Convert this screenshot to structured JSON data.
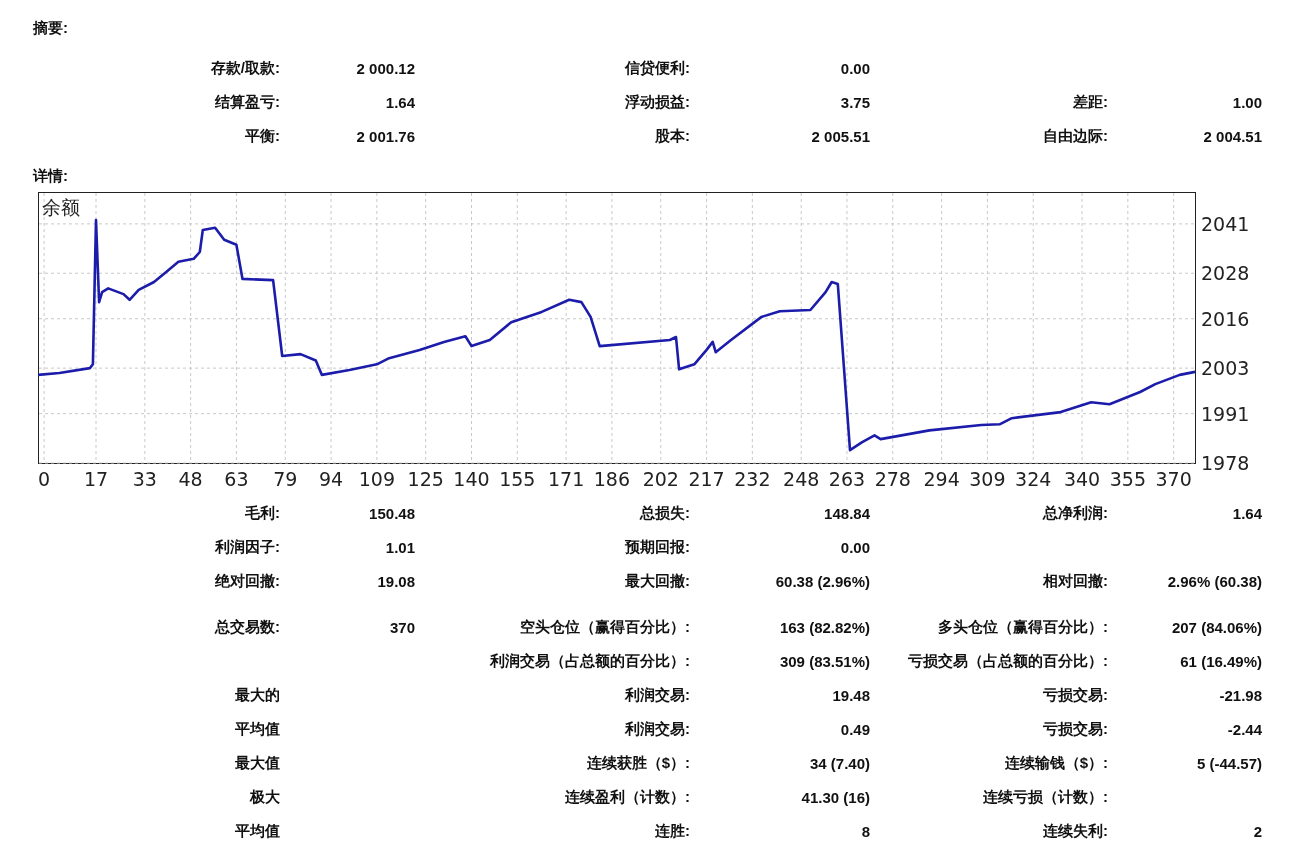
{
  "summary": {
    "heading": "摘要:",
    "rows": [
      {
        "left": {
          "label": "存款/取款:",
          "value": "2 000.12"
        },
        "middle": {
          "label": "信贷便利:",
          "value": "0.00"
        }
      },
      {
        "left": {
          "label": "结算盈亏:",
          "value": "1.64"
        },
        "middle": {
          "label": "浮动损益:",
          "value": "3.75"
        },
        "right": {
          "label": "差距:",
          "value": "1.00"
        }
      },
      {
        "left": {
          "label": "平衡:",
          "value": "2 001.76"
        },
        "middle": {
          "label": "股本:",
          "value": "2 005.51"
        },
        "right": {
          "label": "自由边际:",
          "value": "2 004.51"
        }
      }
    ]
  },
  "details": {
    "heading": "详情:",
    "chart_data": {
      "type": "line",
      "title": "余额",
      "grid": true,
      "xlim": [
        -2,
        377
      ],
      "ylim": [
        1978,
        2049.4
      ],
      "xticks": [
        0,
        17,
        33,
        48,
        63,
        79,
        94,
        109,
        125,
        140,
        155,
        171,
        186,
        202,
        217,
        232,
        248,
        263,
        278,
        294,
        309,
        324,
        340,
        355,
        370
      ],
      "yticks": [
        1978,
        1991,
        2003,
        2016,
        2028,
        2041
      ],
      "x": [
        -2,
        5,
        15,
        16,
        17,
        18,
        19,
        21,
        26,
        28,
        31,
        36,
        40,
        44,
        49,
        51,
        52,
        56,
        59,
        63,
        65,
        75,
        78,
        84,
        89,
        91,
        100,
        109,
        113,
        123,
        131,
        138,
        140,
        146,
        153,
        163,
        172,
        176,
        179,
        182,
        205,
        207,
        208,
        213,
        217,
        219,
        220,
        225,
        235,
        241,
        251,
        256,
        258,
        260,
        264,
        268,
        272,
        274,
        290,
        307,
        313,
        317,
        333,
        343,
        349,
        359,
        364,
        372,
        377
      ],
      "series": [
        {
          "color": "#1c1cab",
          "values": [
            2001.2,
            2001.7,
            2003,
            2004,
            2042,
            2020.4,
            2023,
            2024,
            2022.5,
            2021,
            2023.6,
            2025.7,
            2028.3,
            2031,
            2031.8,
            2033.6,
            2039.4,
            2040,
            2036.8,
            2035.5,
            2026.5,
            2026.2,
            2006.2,
            2006.7,
            2005,
            2001.2,
            2002.5,
            2004,
            2005.6,
            2007.8,
            2009.9,
            2011.4,
            2008.8,
            2010.4,
            2015.1,
            2017.8,
            2021,
            2020.4,
            2016.5,
            2008.8,
            2010.4,
            2011.2,
            2002.7,
            2004,
            2007.8,
            2009.9,
            2007.2,
            2010.4,
            2016.5,
            2018,
            2018.3,
            2023,
            2025.7,
            2025.2,
            1981.4,
            1983.5,
            1985.3,
            1984.3,
            1986.6,
            1988,
            1988.2,
            1989.8,
            1991.4,
            1994,
            1993.5,
            1996.7,
            1998.8,
            2001.2,
            2002
          ]
        }
      ]
    },
    "groups": [
      {
        "rows": [
          {
            "left": {
              "label": "毛利:",
              "value": "150.48"
            },
            "middle": {
              "label": "总损失:",
              "value": "148.84"
            },
            "right": {
              "label": "总净利润:",
              "value": "1.64"
            }
          },
          {
            "left": {
              "label": "利润因子:",
              "value": "1.01"
            },
            "middle": {
              "label": "预期回报:",
              "value": "0.00"
            }
          },
          {
            "left": {
              "label": "绝对回撤:",
              "value": "19.08"
            },
            "middle": {
              "label": "最大回撤:",
              "value": "60.38 (2.96%)"
            },
            "right": {
              "label": "相对回撤:",
              "value": "2.96% (60.38)"
            }
          }
        ]
      },
      {
        "rows": [
          {
            "left": {
              "label": "总交易数:",
              "value": "370"
            },
            "middle": {
              "label": "空头仓位（赢得百分比）:",
              "value": "163 (82.82%)"
            },
            "right": {
              "label": "多头仓位（赢得百分比）:",
              "value": "207 (84.06%)"
            }
          },
          {
            "middle": {
              "label": "利润交易（占总额的百分比）:",
              "value": "309 (83.51%)"
            },
            "right": {
              "label": "亏损交易（占总额的百分比）:",
              "value": "61 (16.49%)"
            }
          },
          {
            "left": {
              "label": "最大的"
            },
            "middle": {
              "label": "利润交易:",
              "value": "19.48"
            },
            "right": {
              "label": "亏损交易:",
              "value": "-21.98"
            }
          },
          {
            "left": {
              "label": "平均值"
            },
            "middle": {
              "label": "利润交易:",
              "value": "0.49"
            },
            "right": {
              "label": "亏损交易:",
              "value": "-2.44"
            }
          },
          {
            "left": {
              "label": "最大值"
            },
            "middle": {
              "label": "连续获胜（$）:",
              "value": "34 (7.40)"
            },
            "right": {
              "label": "连续输钱（$）:",
              "value": "5 (-44.57)"
            }
          },
          {
            "left": {
              "label": "极大"
            },
            "middle": {
              "label": "连续盈利（计数）:",
              "value": "41.30 (16)"
            },
            "right": {
              "label": "连续亏损（计数）:"
            }
          },
          {
            "left": {
              "label": "平均值"
            },
            "middle": {
              "label": "连胜:",
              "value": "8"
            },
            "right": {
              "label": "连续失利:",
              "value": "2"
            }
          }
        ]
      }
    ]
  }
}
